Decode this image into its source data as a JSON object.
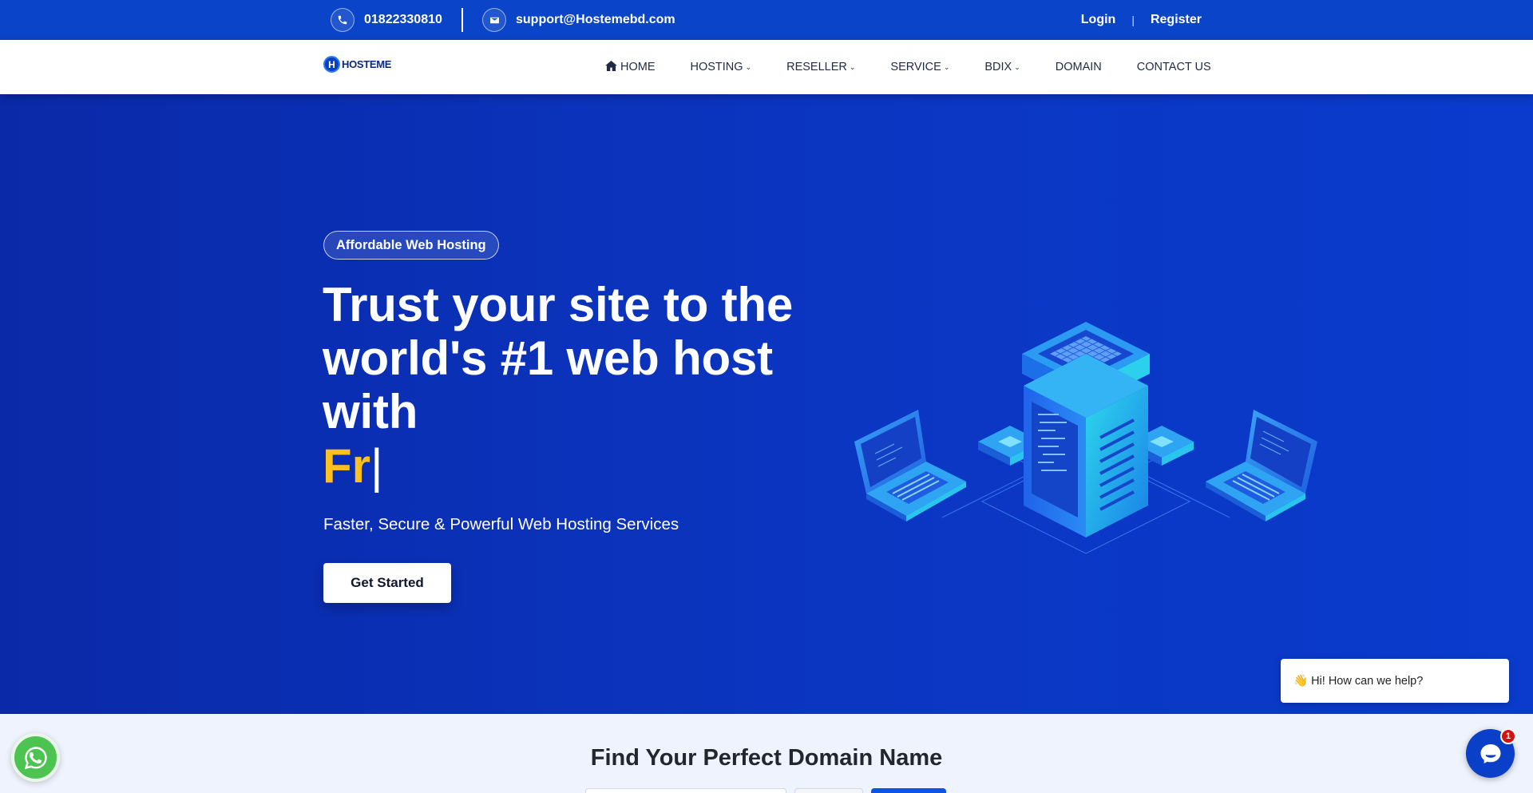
{
  "topbar": {
    "phone": "01822330810",
    "email": "support@Hostemebd.com",
    "login": "Login",
    "separator": "|",
    "register": "Register"
  },
  "nav": {
    "logo_text": "HOSTEME",
    "logo_mark": "H",
    "items": [
      {
        "label": "HOME",
        "icon": "home-icon"
      },
      {
        "label": "HOSTING",
        "dropdown": true
      },
      {
        "label": "RESELLER",
        "dropdown": true
      },
      {
        "label": "SERVICE",
        "dropdown": true
      },
      {
        "label": "BDIX",
        "dropdown": true
      },
      {
        "label": "DOMAIN"
      },
      {
        "label": "CONTACT US"
      }
    ]
  },
  "hero": {
    "badge": "Affordable Web Hosting",
    "headline": "Trust your site to the world's #1 web host with",
    "typed_word": "Fr",
    "cursor": "|",
    "subtitle": "Faster, Secure & Powerful Web Hosting Services",
    "cta": "Get Started"
  },
  "chat": {
    "greeting": "Hi! How can we help?",
    "wave_emoji": "👋",
    "unread_count": "1"
  },
  "domain_section": {
    "title": "Find Your Perfect Domain Name"
  },
  "colors": {
    "topbar_bg": "#0a44c8",
    "hero_bg": "#0b36c2",
    "accent_yellow": "#ffc01e",
    "whatsapp_green": "#4dc452",
    "messenger_blue": "#0a3fc8"
  }
}
